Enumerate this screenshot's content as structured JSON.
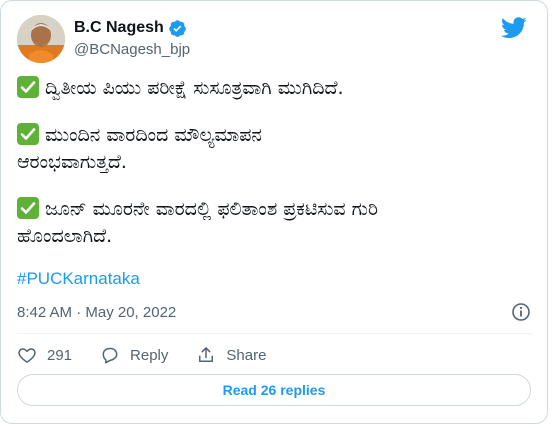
{
  "tweet": {
    "author_name": "B.C Nagesh",
    "handle": "@BCNagesh_bjp",
    "verified_icon": "verified-badge-icon",
    "paragraphs": [
      "ದ್ವಿತೀಯ ಪಿಯು ಪರೀಕ್ಷೆ ಸುಸೂತ್ರವಾಗಿ ಮುಗಿದಿದೆ.",
      "ಮುಂದಿನ ವಾರದಿಂದ ಮೌಲ್ಯಮಾಪನ\nಆರಂಭವಾಗುತ್ತದೆ.",
      "ಜೂನ್ ಮೂರನೇ ವಾರದಲ್ಲಿ ಫಲಿತಾಂಶ ಪ್ರಕಟಿಸುವ ಗುರಿ\nಹೊಂದಲಾಗಿದೆ."
    ],
    "hashtag": "#PUCKarnataka",
    "timestamp": "8:42 AM · May 20, 2022",
    "likes": "291",
    "reply_label": "Reply",
    "share_label": "Share",
    "read_replies_label": "Read 26 replies"
  },
  "colors": {
    "accent": "#1d9bf0",
    "text": "#0f1419",
    "muted": "#536471",
    "check_green": "#5fb238"
  }
}
